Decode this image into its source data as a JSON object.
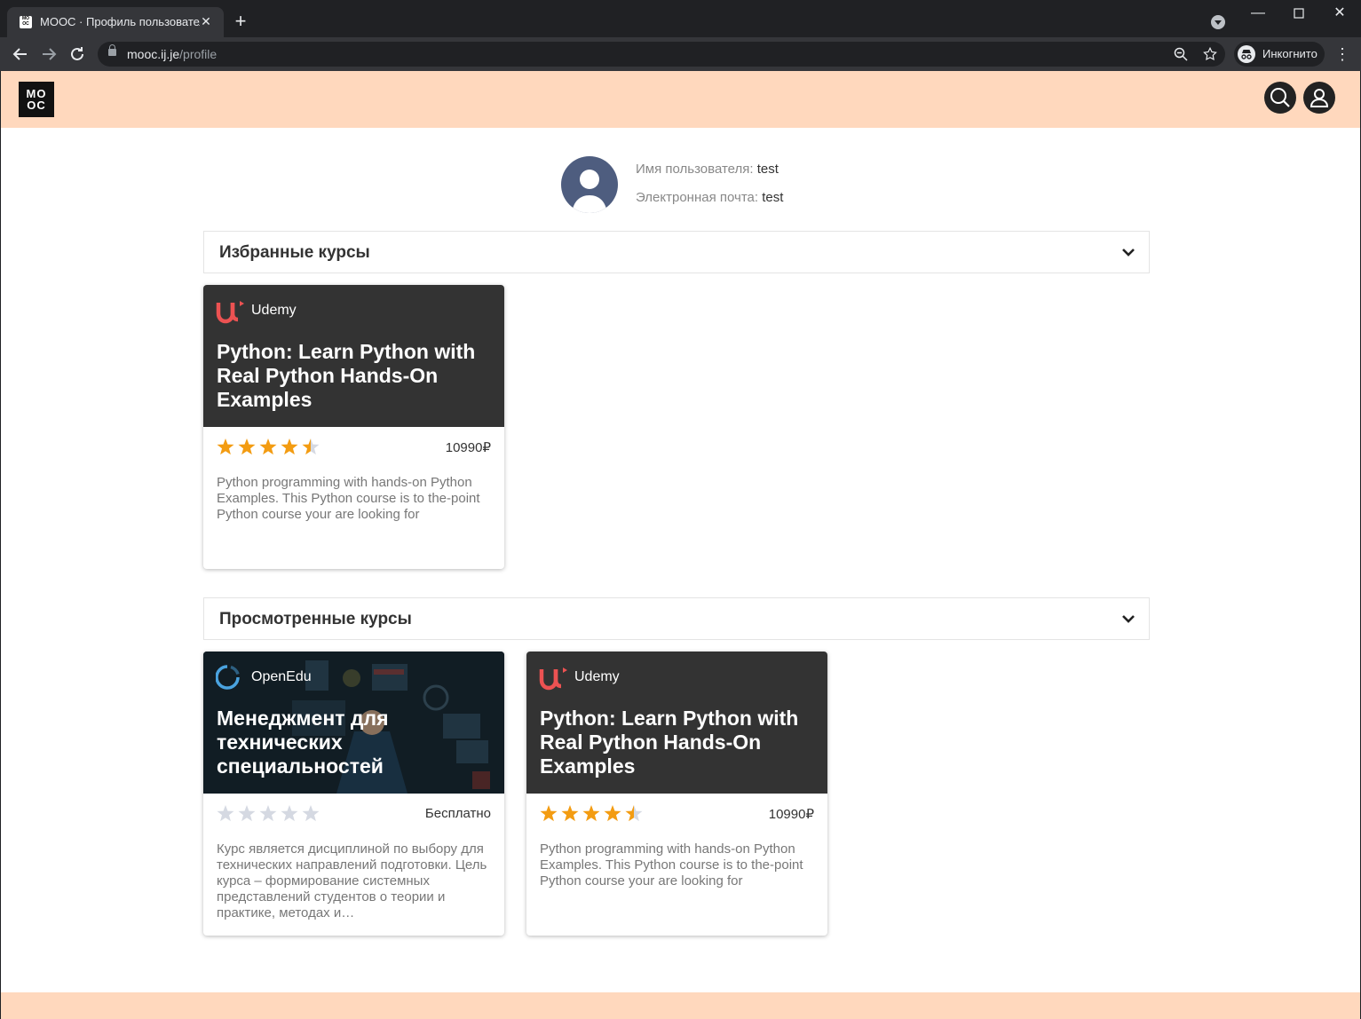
{
  "browser": {
    "tab_title": "MOOC · Профиль пользователя",
    "favicon_text": "MO OC",
    "url_host": "mooc.ij.je",
    "url_path": "/profile",
    "incognito_label": "Инкогнито"
  },
  "site": {
    "logo_text": "MO OC"
  },
  "profile": {
    "username_label": "Имя пользователя:",
    "username_value": "test",
    "email_label": "Электронная почта:",
    "email_value": "test"
  },
  "sections": {
    "favorites_title": "Избранные курсы",
    "viewed_title": "Просмотренные курсы"
  },
  "courses": {
    "fav1": {
      "provider": "Udemy",
      "title": "Python: Learn Python with Real Python Hands-On Examples",
      "rating": 4.5,
      "price": "10990₽",
      "description": "Python programming with hands-on Python Examples. This Python course is to the-point Python course your are looking for"
    },
    "viewed1": {
      "provider": "OpenEdu",
      "title": "Менеджмент для технических специальностей",
      "rating": 0,
      "price": "Бесплатно",
      "description": "Курс является дисциплиной по выбору для технических направлений подготовки. Цель курса – формирование системных представлений студентов о теории и практике, методах и…"
    },
    "viewed2": {
      "provider": "Udemy",
      "title": "Python: Learn Python with Real Python Hands-On Examples",
      "rating": 4.5,
      "price": "10990₽",
      "description": "Python programming with hands-on Python Examples. This Python course is to the-point Python course your are looking for"
    }
  },
  "colors": {
    "header_bg": "#ffd8bd",
    "card_top_bg": "#333333",
    "star_filled": "#f39c12",
    "star_empty": "#d5d9e2",
    "udemy_red": "#ec5252",
    "openedu_blue": "#4aa3df"
  }
}
